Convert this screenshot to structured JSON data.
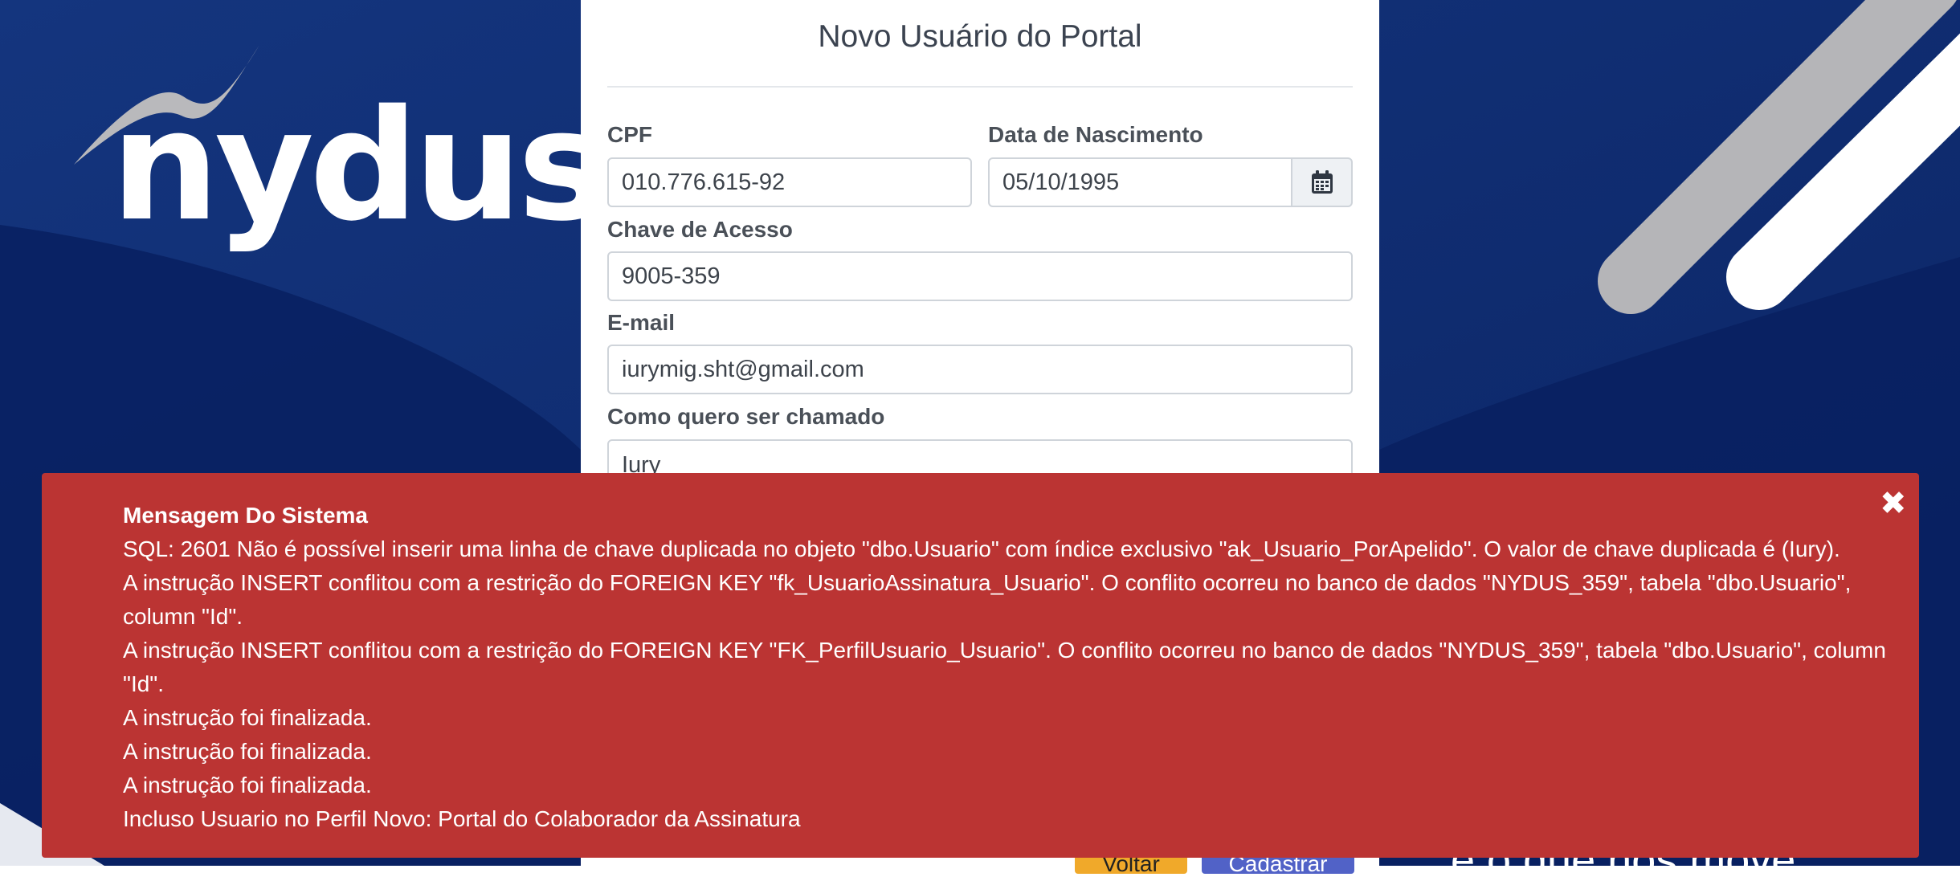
{
  "brand": {
    "logo_text": "nydus"
  },
  "background": {
    "tagline": "e o que nos move."
  },
  "form": {
    "title": "Novo Usuário do Portal",
    "cpf": {
      "label": "CPF",
      "value": "010.776.615-92"
    },
    "birth_date": {
      "label": "Data de Nascimento",
      "value": "05/10/1995"
    },
    "access_key": {
      "label": "Chave de Acesso",
      "value": "9005-359"
    },
    "email": {
      "label": "E-mail",
      "value": "iurymig.sht@gmail.com"
    },
    "nickname": {
      "label": "Como quero ser chamado",
      "value": "Iury"
    },
    "buttons": {
      "back": "Voltar",
      "submit": "Cadastrar"
    }
  },
  "alert": {
    "title": "Mensagem Do Sistema",
    "close_symbol": "✖",
    "lines": [
      "SQL: 2601 Não é possível inserir uma linha de chave duplicada no objeto \"dbo.Usuario\" com índice exclusivo \"ak_Usuario_PorApelido\". O valor de chave duplicada é (Iury).",
      "A instrução INSERT conflitou com a restrição do FOREIGN KEY \"fk_UsuarioAssinatura_Usuario\". O conflito ocorreu no banco de dados \"NYDUS_359\", tabela \"dbo.Usuario\", column \"Id\".",
      "A instrução INSERT conflitou com a restrição do FOREIGN KEY \"FK_PerfilUsuario_Usuario\". O conflito ocorreu no banco de dados \"NYDUS_359\", tabela \"dbo.Usuario\", column \"Id\".",
      "A instrução foi finalizada.",
      "A instrução foi finalizada.",
      "A instrução foi finalizada.",
      "Incluso Usuario no Perfil Novo: Portal do Colaborador da Assinatura"
    ]
  },
  "colors": {
    "background": "#0a2466",
    "alert": "#bb3433",
    "back_button": "#f0a92a",
    "submit_button": "#5162c7"
  },
  "icons": {
    "calendar": "calendar-icon",
    "close": "close-icon"
  }
}
